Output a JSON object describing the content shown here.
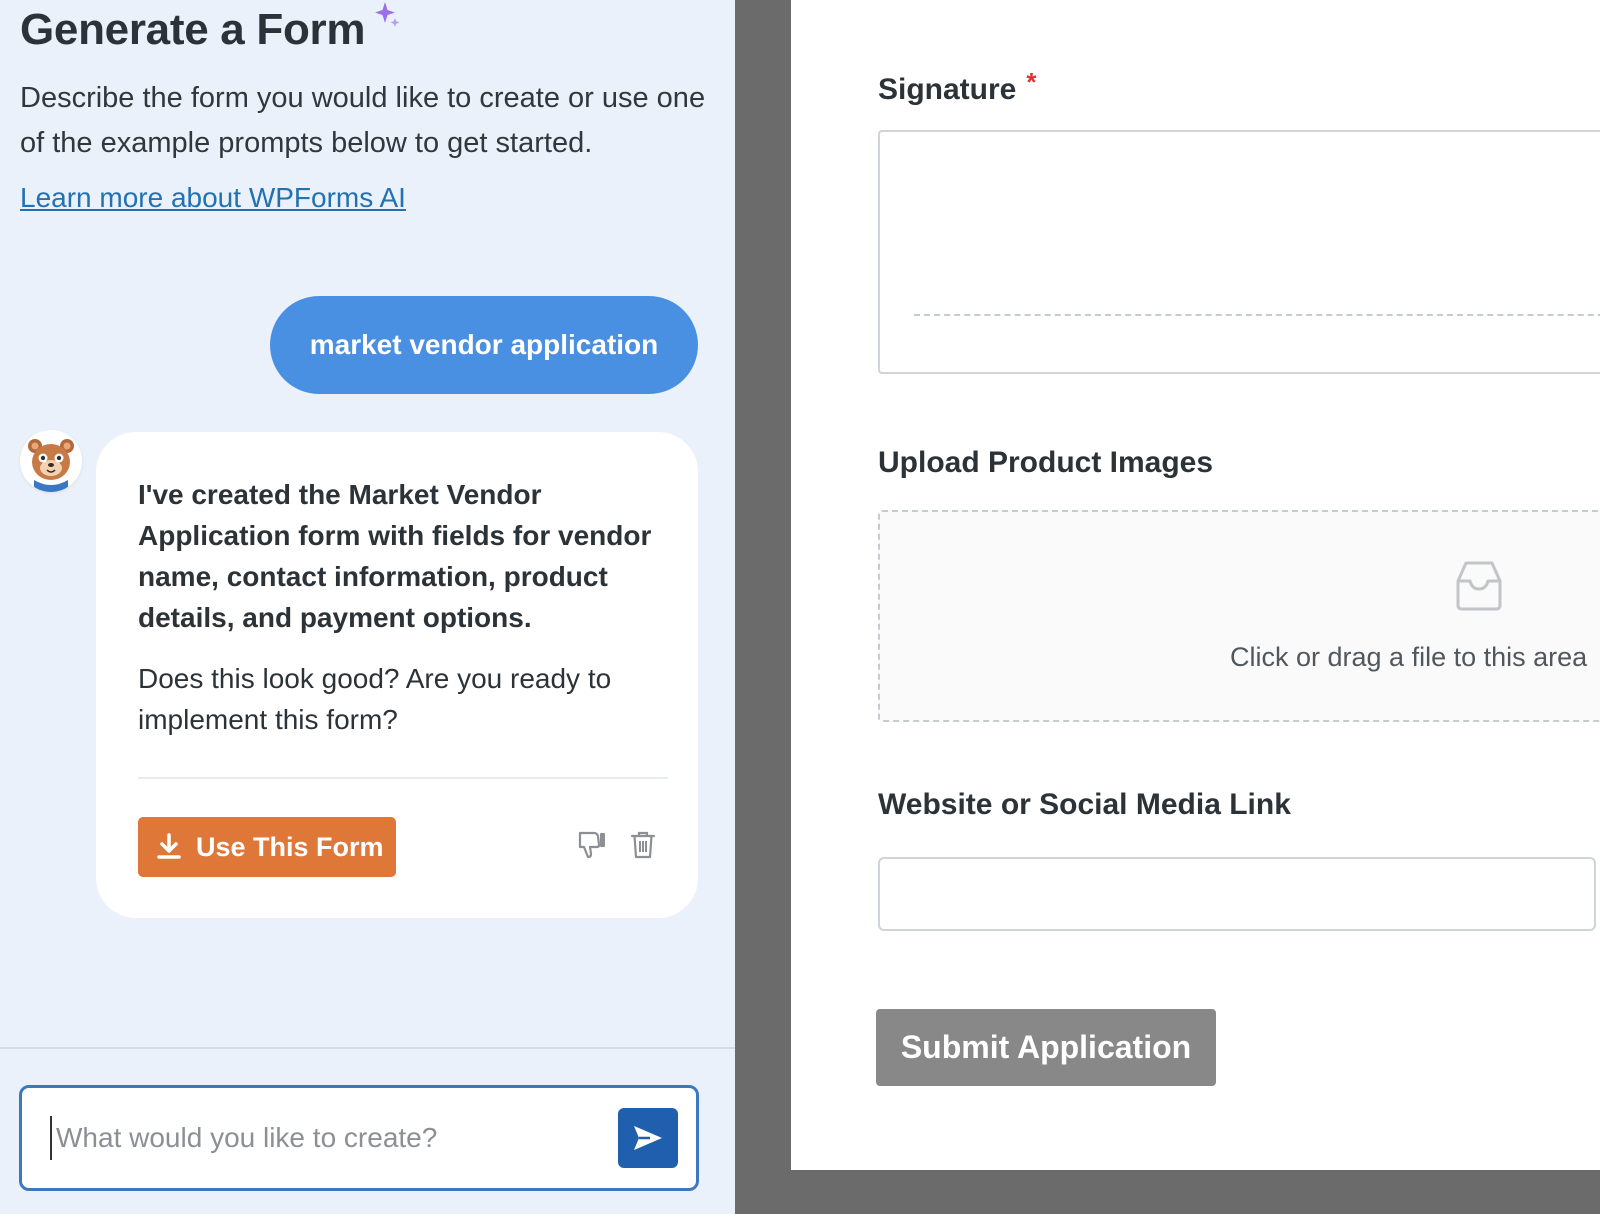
{
  "ai_panel": {
    "title": "Generate a Form",
    "description": "Describe the form you would like to create or use one of the example prompts below to get started.",
    "learn_more_link": "Learn more about WPForms AI",
    "user_prompt": "market vendor application",
    "assistant": {
      "message_bold": "I've created the Market Vendor Application form with fields for vendor name, contact information, product details, and payment options.",
      "message_question": "Does this look good? Are you ready to implement this form?",
      "use_form_button": "Use This Form"
    },
    "prompt_input": {
      "placeholder": "What would you like to create?",
      "value": ""
    }
  },
  "form_preview": {
    "fields": [
      {
        "label": "Signature",
        "required": true,
        "type": "signature"
      },
      {
        "label": "Upload Product Images",
        "required": false,
        "type": "file-upload",
        "upload_hint": "Click or drag a file to this area"
      },
      {
        "label": "Website or Social Media Link",
        "required": false,
        "type": "url"
      }
    ],
    "required_marker": "*",
    "submit_label": "Submit Application"
  },
  "colors": {
    "panel_bg": "#ebf1fa",
    "user_bubble": "#4a90e2",
    "use_form_orange": "#df7739",
    "send_button": "#1f5fad",
    "link": "#2271b1",
    "required": "#d63638",
    "submit_gray": "#888888"
  },
  "icons": {
    "sparkle": "sparkle-icon",
    "avatar": "bear-mascot-avatar",
    "download": "download-icon",
    "thumbs_down": "thumbs-down-icon",
    "trash": "trash-icon",
    "send": "send-arrow-icon",
    "upload": "inbox-upload-icon"
  }
}
